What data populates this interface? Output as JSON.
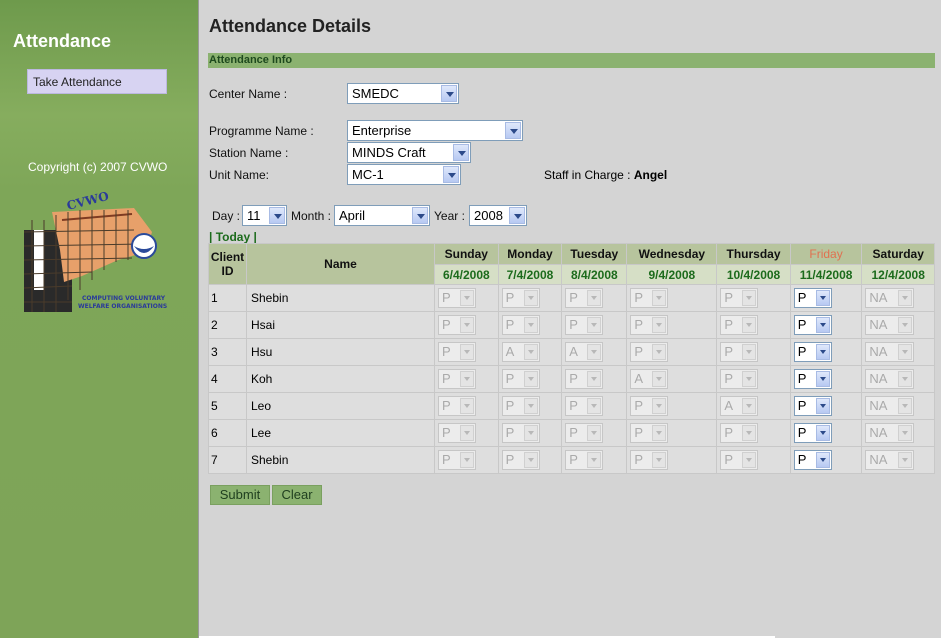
{
  "sidebar": {
    "title": "Attendance",
    "nav_item": "Take Attendance",
    "copyright": "Copyright (c) 2007 CVWO",
    "logo": {
      "text_top": "CVWO",
      "text_bottom_1": "COMPUTING VOLUNTARY",
      "text_bottom_2": "WELFARE ORGANISATIONS"
    }
  },
  "page": {
    "title": "Attendance Details",
    "section": "Attendance Info"
  },
  "form": {
    "center_label": "Center Name :",
    "center_value": "SMEDC",
    "programme_label": "Programme Name :",
    "programme_value": "Enterprise",
    "station_label": "Station Name :",
    "station_value": "MINDS Craft",
    "unit_label": "Unit Name:",
    "unit_value": "MC-1",
    "staff_label": "Staff in Charge :",
    "staff_value": "Angel",
    "day_label": "Day :",
    "day_value": "11",
    "month_label": "Month :",
    "month_value": "April",
    "year_label": "Year :",
    "year_value": "2008",
    "today_link": "| Today |"
  },
  "table": {
    "col_client_id": "Client ID",
    "col_name": "Name",
    "days": [
      {
        "name": "Sunday",
        "date": "6/4/2008"
      },
      {
        "name": "Monday",
        "date": "7/4/2008"
      },
      {
        "name": "Tuesday",
        "date": "8/4/2008"
      },
      {
        "name": "Wednesday",
        "date": "9/4/2008"
      },
      {
        "name": "Thursday",
        "date": "10/4/2008"
      },
      {
        "name": "Friday",
        "date": "11/4/2008"
      },
      {
        "name": "Saturday",
        "date": "12/4/2008"
      }
    ],
    "rows": [
      {
        "id": "1",
        "name": "Shebin",
        "values": [
          "P",
          "P",
          "P",
          "P",
          "P",
          "P",
          "NA"
        ]
      },
      {
        "id": "2",
        "name": "Hsai",
        "values": [
          "P",
          "P",
          "P",
          "P",
          "P",
          "P",
          "NA"
        ]
      },
      {
        "id": "3",
        "name": "Hsu",
        "values": [
          "P",
          "A",
          "A",
          "P",
          "P",
          "P",
          "NA"
        ]
      },
      {
        "id": "4",
        "name": "Koh",
        "values": [
          "P",
          "P",
          "P",
          "A",
          "P",
          "P",
          "NA"
        ]
      },
      {
        "id": "5",
        "name": "Leo",
        "values": [
          "P",
          "P",
          "P",
          "P",
          "A",
          "P",
          "NA"
        ]
      },
      {
        "id": "6",
        "name": "Lee",
        "values": [
          "P",
          "P",
          "P",
          "P",
          "P",
          "P",
          "NA"
        ]
      },
      {
        "id": "7",
        "name": "Shebin",
        "values": [
          "P",
          "P",
          "P",
          "P",
          "P",
          "P",
          "NA"
        ]
      }
    ]
  },
  "buttons": {
    "submit": "Submit",
    "clear": "Clear"
  },
  "colors": {
    "sidebar_green": "#7ea458",
    "bar_green": "#8bb270",
    "friday_highlight": "#e07050",
    "date_green": "#1c6b1c"
  }
}
